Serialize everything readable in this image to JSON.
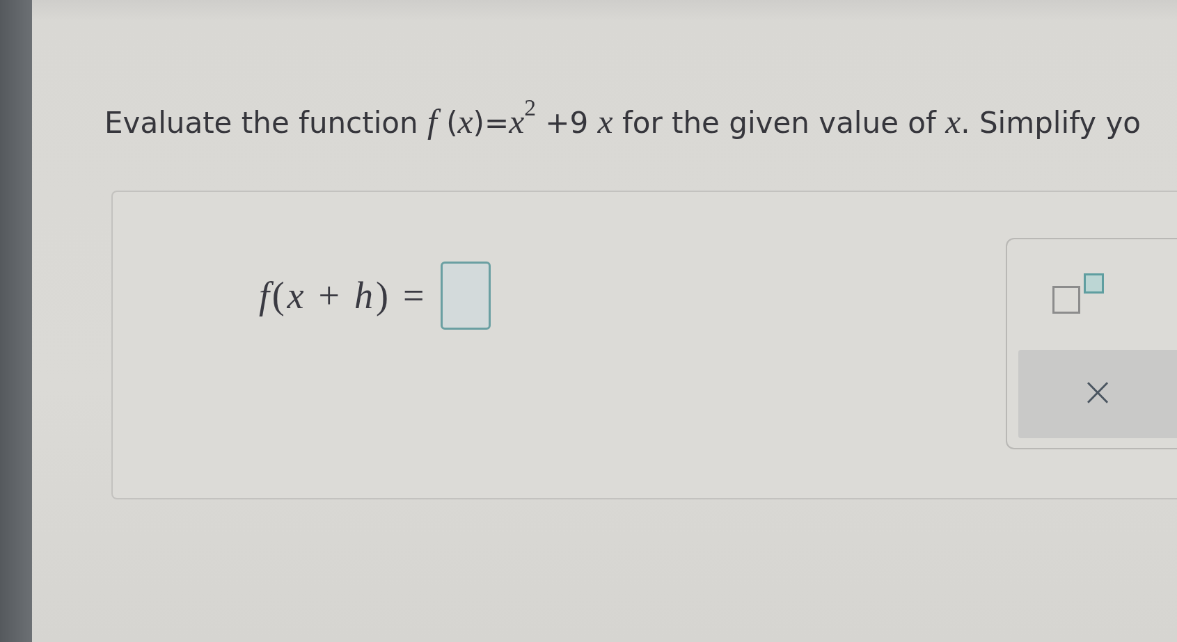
{
  "question": {
    "text": "Evaluate the function *f* (*x*)=*x*$^{2}$ +9 *x* for the given value of *x*. Simplify yo"
  },
  "answer": {
    "label": "*f*(*x* + *h*) ="
  },
  "toolbar": {
    "actions": [
      "×"
    ]
  }
}
